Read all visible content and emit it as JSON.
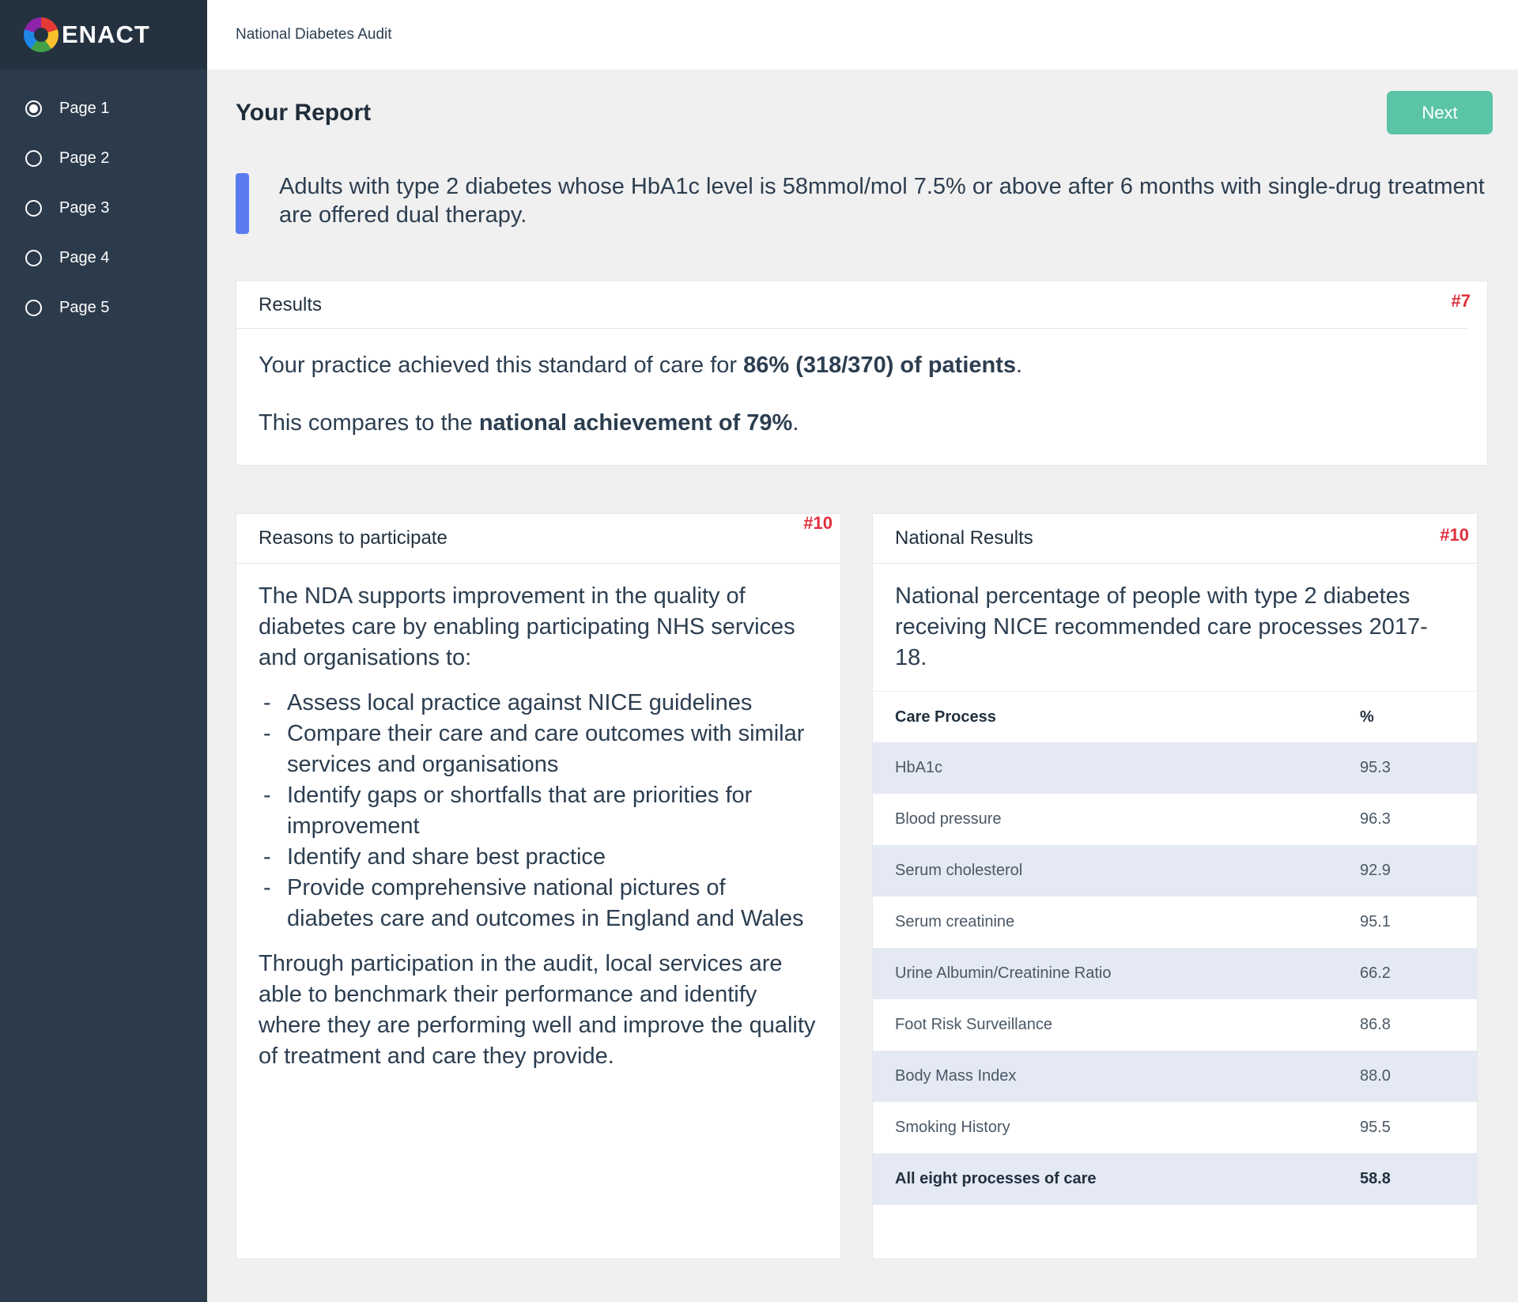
{
  "brand": {
    "name": "ENACT"
  },
  "sidebar": {
    "items": [
      {
        "label": "Page 1",
        "selected": true
      },
      {
        "label": "Page 2",
        "selected": false
      },
      {
        "label": "Page 3",
        "selected": false
      },
      {
        "label": "Page 4",
        "selected": false
      },
      {
        "label": "Page 5",
        "selected": false
      }
    ]
  },
  "header": {
    "app_title": "National Diabetes Audit"
  },
  "page": {
    "title": "Your Report",
    "next_label": "Next",
    "standard_text": "Adults with type 2 diabetes whose HbA1c level is 58mmol/mol 7.5% or above after 6 months with single-drug treatment are offered dual therapy."
  },
  "results": {
    "title": "Results",
    "tag": "#7",
    "line1_prefix": "Your practice achieved this standard of care for ",
    "line1_bold": "86% (318/370) of patients",
    "line1_suffix": ".",
    "line2_prefix": "This compares to the ",
    "line2_bold": "national achievement of 79%",
    "line2_suffix": "."
  },
  "reasons": {
    "title": "Reasons to participate",
    "tag": "#10",
    "intro": "The NDA supports improvement in the quality of diabetes care by enabling participating NHS services and organisations to:",
    "bullets": [
      "Assess local practice against NICE guidelines",
      "Compare their care and care outcomes with similar services and organisations",
      "Identify gaps or shortfalls that are priorities for improvement",
      "Identify and share best practice",
      "Provide comprehensive national pictures of diabetes care and outcomes in England and Wales"
    ],
    "closing": "Through participation in the audit, local services are able to benchmark their performance and identify where they are performing well and improve the quality of treatment and care they provide."
  },
  "national": {
    "title": "National Results",
    "tag": "#10",
    "description": "National percentage of people with type 2 diabetes receiving NICE recommended care processes 2017-18.",
    "columns": [
      "Care Process",
      "%"
    ],
    "rows": [
      {
        "process": "HbA1c",
        "value": "95.3"
      },
      {
        "process": "Blood pressure",
        "value": "96.3"
      },
      {
        "process": "Serum cholesterol",
        "value": "92.9"
      },
      {
        "process": "Serum creatinine",
        "value": "95.1"
      },
      {
        "process": "Urine Albumin/Creatinine Ratio",
        "value": "66.2"
      },
      {
        "process": "Foot Risk Surveillance",
        "value": "86.8"
      },
      {
        "process": "Body Mass Index",
        "value": "88.0"
      },
      {
        "process": "Smoking History",
        "value": "95.5"
      },
      {
        "process": "All eight processes of care",
        "value": "58.8"
      }
    ]
  },
  "colors": {
    "sidebar": "#2c3b4c",
    "accent_button": "#5bc4a6",
    "standard_bar": "#5b7cf0",
    "tag": "#e0303c",
    "row_shade": "#e4e9f3"
  }
}
